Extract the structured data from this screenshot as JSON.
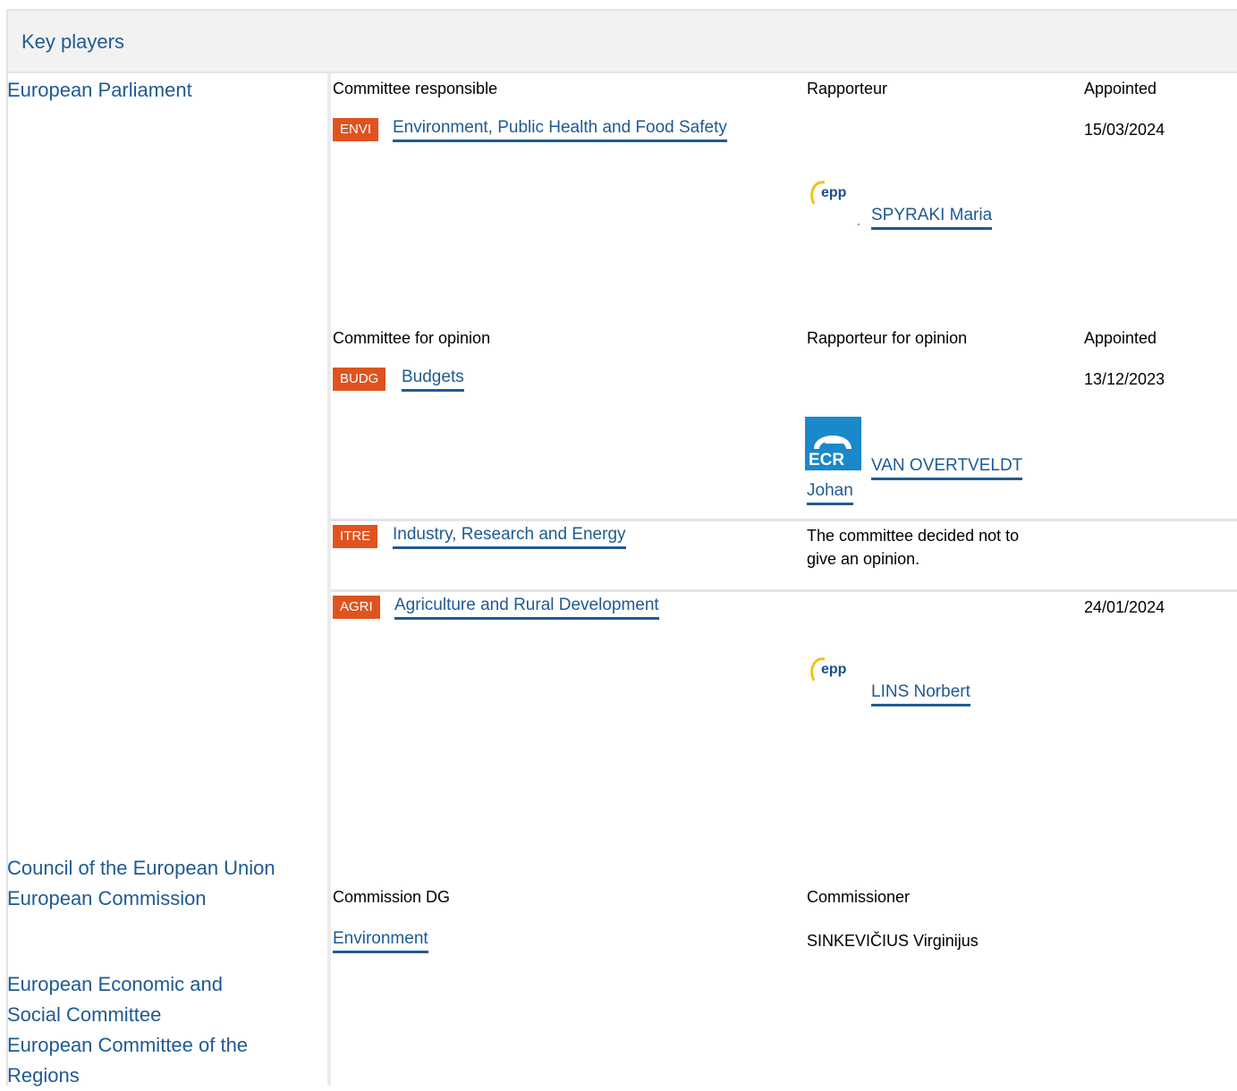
{
  "header": {
    "title": "Key players"
  },
  "institutions": {
    "parliament": "European Parliament",
    "council": "Council of the European Union",
    "commission": "European Commission",
    "eesc_line1": "European Economic and",
    "eesc_line2": "Social Committee",
    "cor_line1": "European Committee of the",
    "cor_line2": "Regions"
  },
  "responsible": {
    "col_committee": "Committee responsible",
    "col_rapporteur": "Rapporteur",
    "col_appointed": "Appointed",
    "badge": "ENVI",
    "committee": "Environment, Public Health and Food Safety",
    "appointed": "15/03/2024",
    "rapporteur": "SPYRAKI Maria",
    "group_logo": "epp-logo"
  },
  "opinion": {
    "col_committee": "Committee for opinion",
    "col_rapporteur": "Rapporteur for opinion",
    "col_appointed": "Appointed",
    "rows": [
      {
        "badge": "BUDG",
        "committee": "Budgets",
        "appointed": "13/12/2023",
        "rapporteur_line1": "VAN OVERTVELDT",
        "rapporteur_line2": "Johan",
        "group_logo": "ecr-logo"
      },
      {
        "badge": "ITRE",
        "committee": "Industry, Research and Energy",
        "note_line1": "The committee decided not to",
        "note_line2": "give an opinion."
      },
      {
        "badge": "AGRI",
        "committee": "Agriculture and Rural Development",
        "appointed": "24/01/2024",
        "rapporteur": "LINS Norbert",
        "group_logo": "epp-logo"
      }
    ]
  },
  "commission_block": {
    "col_dg": "Commission DG",
    "col_commissioner": "Commissioner",
    "dg": "Environment",
    "commissioner": "SINKEVIČIUS Virginijus"
  },
  "colors": {
    "link": "#1f5a92",
    "badge": "#e0531f",
    "header_bg": "#f2f2f2"
  }
}
